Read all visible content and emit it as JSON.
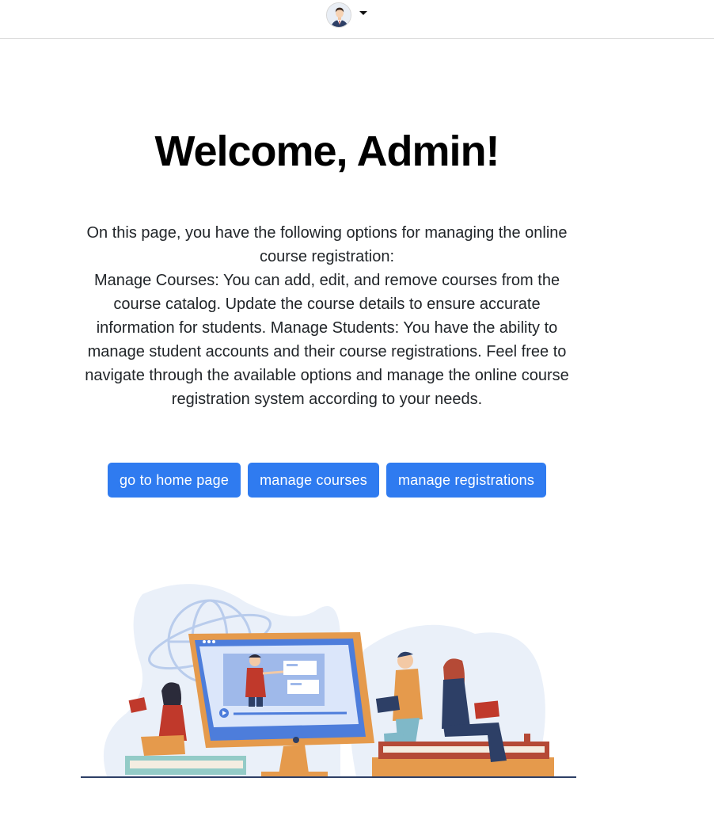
{
  "header": {
    "avatar_icon": "user-avatar-icon",
    "menu_icon": "caret-down-icon"
  },
  "main": {
    "title": "Welcome, Admin!",
    "intro": "On this page, you have the following options for managing the online course registration:",
    "details": "Manage Courses: You can add, edit, and remove courses from the course catalog. Update the course details to ensure accurate information for students. Manage Students: You have the ability to manage student accounts and their course registrations. Feel free to navigate through the available options and manage the online course registration system according to your needs.",
    "buttons": {
      "home": "go to home page",
      "courses": "manage courses",
      "registrations": "manage registrations"
    }
  },
  "colors": {
    "accent": "#2f7bf0",
    "divider": "#dcdcdc"
  }
}
